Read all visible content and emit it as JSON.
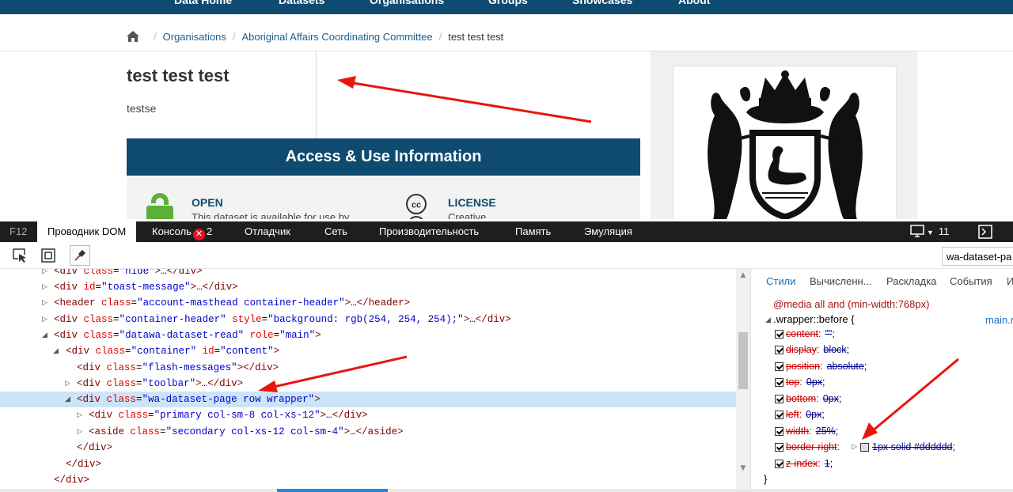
{
  "nav": {
    "items": [
      "Data Home",
      "Datasets",
      "Organisations",
      "Groups",
      "Showcases",
      "About"
    ]
  },
  "breadcrumb": {
    "items": [
      "Organisations",
      "Aboriginal Affairs Coordinating Committee",
      "test test test"
    ]
  },
  "dataset": {
    "title": "test test test",
    "description": "testse"
  },
  "access": {
    "heading": "Access & Use Information",
    "open_label": "OPEN",
    "open_desc": "This dataset is available for use by",
    "license_label": "LICENSE",
    "license_desc": "Creative"
  },
  "devtools": {
    "f12": "F12",
    "tabs": [
      "Проводник DOM",
      "Консоль",
      "Отладчик",
      "Сеть",
      "Производительность",
      "Память",
      "Эмуляция"
    ],
    "console_errors": "2",
    "doc_mode": "11",
    "selector_input": "wa-dataset-pa"
  },
  "dom_tree": [
    {
      "arrow": "right",
      "html": "<span class=\"tag\">&lt;div</span> <span class=\"attr\">class</span>=<span class=\"val\">\"hide\"</span><span class=\"tag\">&gt;</span>…<span class=\"tag\">&lt;/div&gt;</span>"
    },
    {
      "arrow": "right",
      "html": "<span class=\"tag\">&lt;div</span> <span class=\"attr\">id</span>=<span class=\"val\">\"toast-message\"</span><span class=\"tag\">&gt;</span>…<span class=\"tag\">&lt;/div&gt;</span>"
    },
    {
      "arrow": "right",
      "html": "<span class=\"tag\">&lt;header</span> <span class=\"attr\">class</span>=<span class=\"val\">\"account-masthead container-header\"</span><span class=\"tag\">&gt;</span>…<span class=\"tag\">&lt;/header&gt;</span>"
    },
    {
      "arrow": "right",
      "html": "<span class=\"tag\">&lt;div</span> <span class=\"attr\">class</span>=<span class=\"val\">\"container-header\"</span> <span class=\"attr\">style</span>=<span class=\"val\">\"background: rgb(254, 254, 254);\"</span><span class=\"tag\">&gt;</span>…<span class=\"tag\">&lt;/div&gt;</span>"
    },
    {
      "arrow": "down",
      "html": "<span class=\"tag\">&lt;div</span> <span class=\"attr\">class</span>=<span class=\"val\">\"datawa-dataset-read\"</span> <span class=\"attr\">role</span>=<span class=\"val\">\"main\"</span><span class=\"tag\">&gt;</span>"
    },
    {
      "arrow": "down",
      "html": "<span class=\"tag\">&lt;div</span> <span class=\"attr\">class</span>=<span class=\"val\">\"container\"</span> <span class=\"attr\">id</span>=<span class=\"val\">\"content\"</span><span class=\"tag\">&gt;</span>"
    },
    {
      "arrow": "",
      "html": "<span class=\"tag\">&lt;div</span> <span class=\"attr\">class</span>=<span class=\"val\">\"flash-messages\"</span><span class=\"tag\">&gt;&lt;/div&gt;</span>"
    },
    {
      "arrow": "right",
      "html": "<span class=\"tag\">&lt;div</span> <span class=\"attr\">class</span>=<span class=\"val\">\"toolbar\"</span><span class=\"tag\">&gt;</span>…<span class=\"tag\">&lt;/div&gt;</span>"
    },
    {
      "arrow": "down",
      "html": "<span class=\"tag\">&lt;div</span> <span class=\"attr\">class</span>=<span class=\"val\">\"wa-dataset-page row wrapper\"</span><span class=\"tag\">&gt;</span>"
    },
    {
      "arrow": "right",
      "html": "<span class=\"tag\">&lt;div</span> <span class=\"attr\">class</span>=<span class=\"val\">\"primary col-sm-8 col-xs-12\"</span><span class=\"tag\">&gt;</span>…<span class=\"tag\">&lt;/div&gt;</span>"
    },
    {
      "arrow": "right",
      "html": "<span class=\"tag\">&lt;aside</span> <span class=\"attr\">class</span>=<span class=\"val\">\"secondary col-xs-12 col-sm-4\"</span><span class=\"tag\">&gt;</span>…<span class=\"tag\">&lt;/aside&gt;</span>"
    },
    {
      "arrow": "",
      "html": "<span class=\"tag\">&lt;/div&gt;</span>"
    },
    {
      "arrow": "",
      "html": "<span class=\"tag\">&lt;/div&gt;</span>"
    },
    {
      "arrow": "",
      "html": "<span class=\"tag\">&lt;/div&gt;</span>"
    }
  ],
  "styles": {
    "tabs": [
      "Стили",
      "Вычисленн...",
      "Раскладка",
      "События",
      "И"
    ],
    "media": "@media all and (min-width:768px)",
    "selector": ".wrapper::before",
    "source": "main.m",
    "props": [
      {
        "name": "content",
        "value": "\"\""
      },
      {
        "name": "display",
        "value": "block"
      },
      {
        "name": "position",
        "value": "absolute"
      },
      {
        "name": "top",
        "value": "0px"
      },
      {
        "name": "bottom",
        "value": "0px"
      },
      {
        "name": "left",
        "value": "0px"
      },
      {
        "name": "width",
        "value": "25%"
      },
      {
        "name": "border-right",
        "value": "1px solid #dddddd"
      },
      {
        "name": "z-index",
        "value": "1"
      }
    ],
    "close_brace": "}"
  },
  "colors": {
    "brand_blue": "#0f4a71",
    "selection": "#cce4f7",
    "arrow_red": "#e8150d"
  }
}
